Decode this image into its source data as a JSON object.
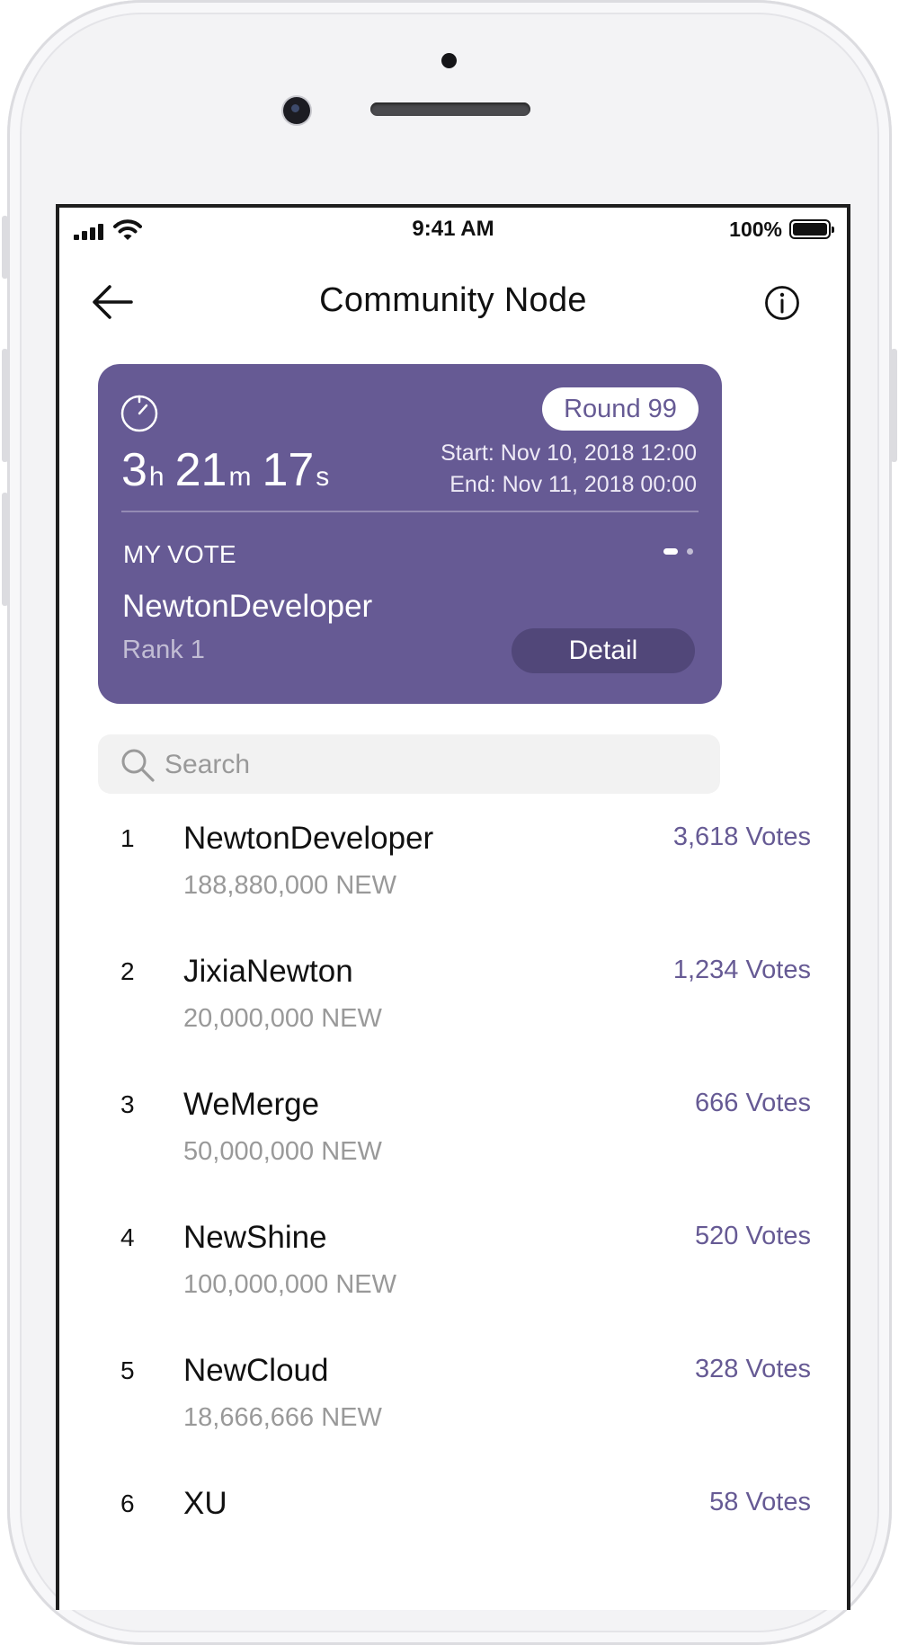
{
  "status_bar": {
    "time": "9:41 AM",
    "battery": "100%"
  },
  "header": {
    "title": "Community Node",
    "back_icon": "arrow-left-icon",
    "info_icon": "info-circle-icon"
  },
  "card": {
    "timer_icon": "stopwatch-icon",
    "countdown": {
      "hours": "3",
      "hours_unit": "h",
      "minutes": "21",
      "minutes_unit": "m",
      "seconds": "17",
      "seconds_unit": "s"
    },
    "round": "Round 99",
    "start": "Start: Nov 10, 2018 12:00",
    "end": "End: Nov 11, 2018 00:00",
    "my_vote_label": "MY VOTE",
    "vote_name": "NewtonDeveloper",
    "vote_rank": "Rank 1",
    "detail_button": "Detail",
    "color": "#665a94"
  },
  "search": {
    "placeholder": "Search",
    "icon": "search-icon"
  },
  "nodes": [
    {
      "rank": "1",
      "name": "NewtonDeveloper",
      "amount": "188,880,000 NEW",
      "votes": "3,618 Votes"
    },
    {
      "rank": "2",
      "name": "JixiaNewton",
      "amount": "20,000,000 NEW",
      "votes": "1,234 Votes"
    },
    {
      "rank": "3",
      "name": "WeMerge",
      "amount": "50,000,000 NEW",
      "votes": "666 Votes"
    },
    {
      "rank": "4",
      "name": "NewShine",
      "amount": "100,000,000 NEW",
      "votes": "520 Votes"
    },
    {
      "rank": "5",
      "name": "NewCloud",
      "amount": "18,666,666 NEW",
      "votes": "328 Votes"
    },
    {
      "rank": "6",
      "name": "XU",
      "amount": "",
      "votes": "58 Votes"
    }
  ]
}
